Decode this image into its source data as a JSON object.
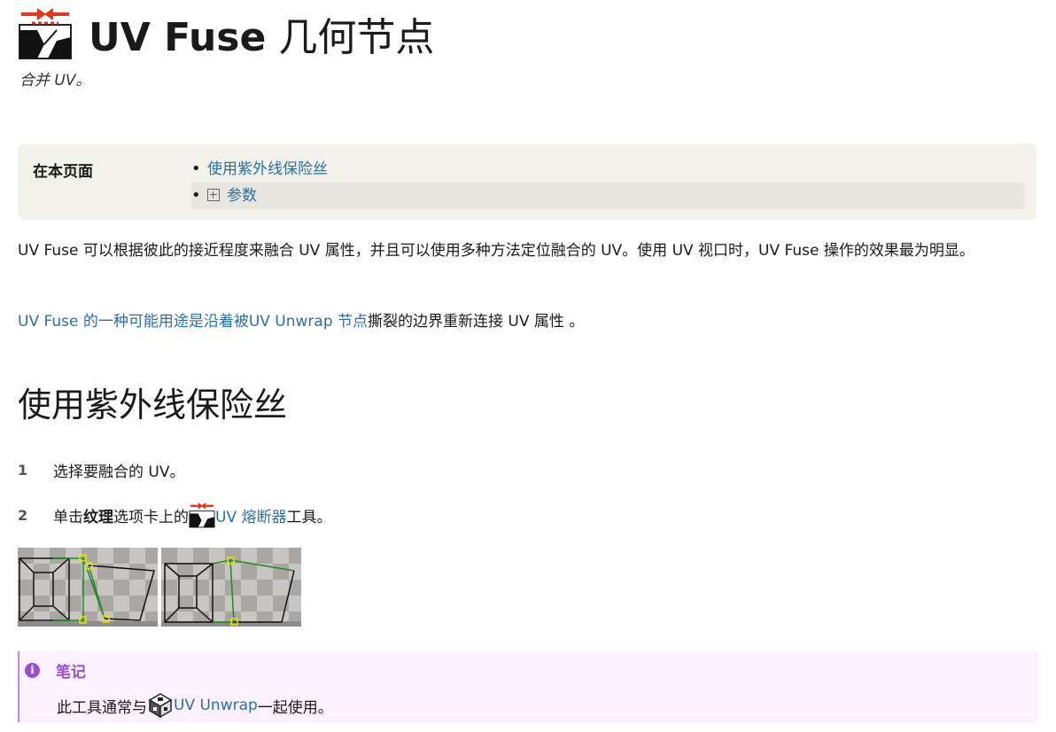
{
  "header": {
    "title_bold": "UV Fuse",
    "title_rest": " 几何节点",
    "summary": "合并 UV。",
    "icon": "uv-fuse-icon"
  },
  "toc": {
    "label": "在本页面",
    "items": [
      {
        "label": "使用紫外线保险丝"
      },
      {
        "label": "参数",
        "expandable": true
      }
    ]
  },
  "intro": {
    "text": "UV Fuse 可以根据彼此的接近程度来融合 UV 属性，并且可以使用多种方法定位融合的 UV。使用 UV 视口时，UV Fuse 操作的效果最为明显。",
    "link_text": "UV Fuse 的一种可能用途是沿着被UV Unwrap 节点",
    "after_link": "撕裂的边界重新连接 UV 属性 。"
  },
  "section": {
    "heading": "使用紫外线保险丝",
    "steps": [
      {
        "num": "1",
        "text": "选择要融合的 UV。"
      },
      {
        "num": "2",
        "pre": "单击",
        "bold": "纹理",
        "mid": "选项卡上的",
        "link": "UV 熔断器",
        "post": "工具。"
      }
    ]
  },
  "note": {
    "title": "笔记",
    "pre": "此工具通常与",
    "link": "UV Unwrap",
    "post": "一起使用。",
    "icon": "info-icon"
  },
  "colors": {
    "link": "#2a6fa8",
    "toc_bg": "#f3f2ea",
    "note_bg": "#fbf1ff",
    "note_accent": "#9a4fd0"
  }
}
